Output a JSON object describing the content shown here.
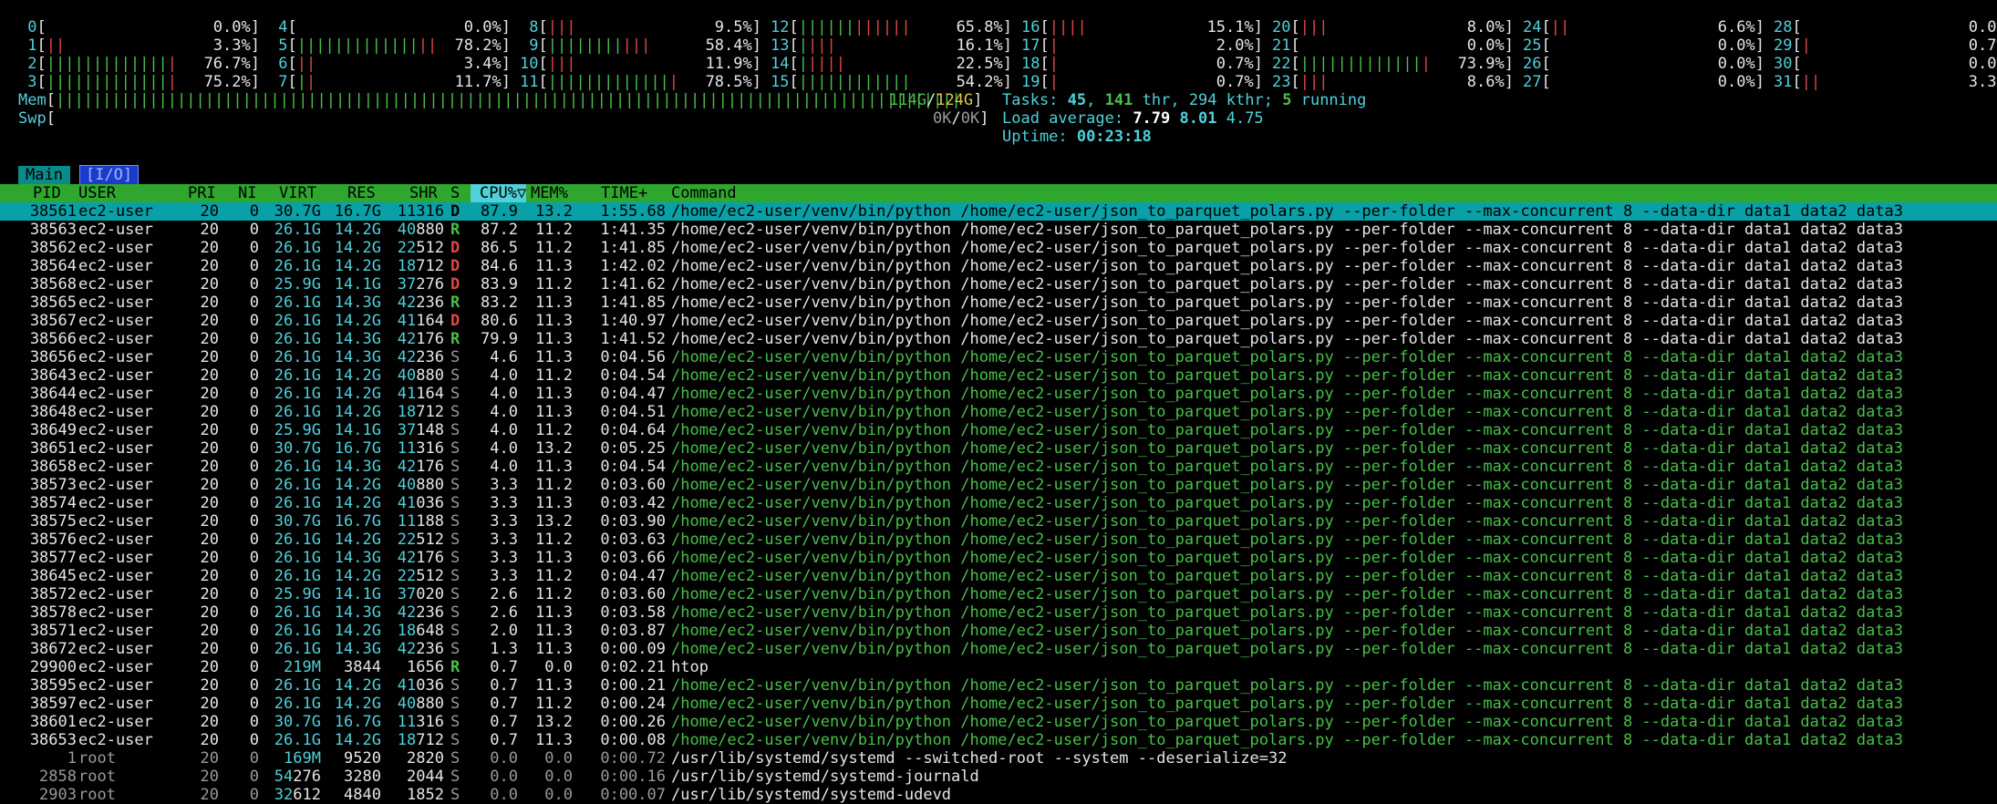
{
  "cpu_meters": [
    {
      "id": "0",
      "pct": "0.0%",
      "green": "",
      "red": "",
      "col": 0,
      "row": 0
    },
    {
      "id": "1",
      "pct": "3.3%",
      "green": "",
      "red": "||",
      "col": 0,
      "row": 1
    },
    {
      "id": "2",
      "pct": "76.7%",
      "green": "|||||||||||||",
      "red": "|",
      "col": 0,
      "row": 2
    },
    {
      "id": "3",
      "pct": "75.2%",
      "green": "|||||||||||||",
      "red": "|",
      "col": 0,
      "row": 3
    },
    {
      "id": "4",
      "pct": "0.0%",
      "green": "",
      "red": "",
      "col": 1,
      "row": 0
    },
    {
      "id": "5",
      "pct": "78.2%",
      "green": "|||||||||||||",
      "red": "||",
      "col": 1,
      "row": 1
    },
    {
      "id": "6",
      "pct": "3.4%",
      "green": "",
      "red": "||",
      "col": 1,
      "row": 2
    },
    {
      "id": "7",
      "pct": "11.7%",
      "green": "|",
      "red": "|",
      "col": 1,
      "row": 3
    },
    {
      "id": "8",
      "pct": "9.5%",
      "green": "",
      "red": "|||",
      "col": 2,
      "row": 0
    },
    {
      "id": "9",
      "pct": "58.4%",
      "green": "||||||||",
      "red": "|||",
      "col": 2,
      "row": 1
    },
    {
      "id": "10",
      "pct": "11.9%",
      "green": "",
      "red": "|||",
      "col": 2,
      "row": 2
    },
    {
      "id": "11",
      "pct": "78.5%",
      "green": "|||||||||||||",
      "red": "|",
      "col": 2,
      "row": 3
    },
    {
      "id": "12",
      "pct": "65.8%",
      "green": "||||||",
      "red": "||||||",
      "col": 3,
      "row": 0
    },
    {
      "id": "13",
      "pct": "16.1%",
      "green": "|",
      "red": "|||",
      "col": 3,
      "row": 1
    },
    {
      "id": "14",
      "pct": "22.5%",
      "green": "|",
      "red": "||||",
      "col": 3,
      "row": 2
    },
    {
      "id": "15",
      "pct": "54.2%",
      "green": "||||||||||||",
      "red": "",
      "col": 3,
      "row": 3
    },
    {
      "id": "16",
      "pct": "15.1%",
      "green": "",
      "red": "||||",
      "col": 4,
      "row": 0
    },
    {
      "id": "17",
      "pct": "2.0%",
      "green": "",
      "red": "|",
      "col": 4,
      "row": 1
    },
    {
      "id": "18",
      "pct": "0.7%",
      "green": "",
      "red": "|",
      "col": 4,
      "row": 2
    },
    {
      "id": "19",
      "pct": "0.7%",
      "green": "",
      "red": "|",
      "col": 4,
      "row": 3
    },
    {
      "id": "20",
      "pct": "8.0%",
      "green": "",
      "red": "|||",
      "col": 5,
      "row": 0
    },
    {
      "id": "21",
      "pct": "0.0%",
      "green": "",
      "red": "",
      "col": 5,
      "row": 1
    },
    {
      "id": "22",
      "pct": "73.9%",
      "green": "|||||||||||||",
      "red": "|",
      "col": 5,
      "row": 2
    },
    {
      "id": "23",
      "pct": "8.6%",
      "green": "",
      "red": "|||",
      "col": 5,
      "row": 3
    },
    {
      "id": "24",
      "pct": "6.6%",
      "green": "",
      "red": "||",
      "col": 6,
      "row": 0
    },
    {
      "id": "25",
      "pct": "0.0%",
      "green": "",
      "red": "",
      "col": 6,
      "row": 1
    },
    {
      "id": "26",
      "pct": "0.0%",
      "green": "",
      "red": "",
      "col": 6,
      "row": 2
    },
    {
      "id": "27",
      "pct": "0.0%",
      "green": "",
      "red": "",
      "col": 6,
      "row": 3
    },
    {
      "id": "28",
      "pct": "0.0%",
      "green": "",
      "red": "",
      "col": 7,
      "row": 0
    },
    {
      "id": "29",
      "pct": "0.7%",
      "green": "",
      "red": "|",
      "col": 7,
      "row": 1
    },
    {
      "id": "30",
      "pct": "0.0%",
      "green": "",
      "red": "",
      "col": 7,
      "row": 2
    },
    {
      "id": "31",
      "pct": "3.3%",
      "green": "",
      "red": "||",
      "col": 7,
      "row": 3
    }
  ],
  "mem": {
    "label": "Mem",
    "used": "114G",
    "total": "124G",
    "bar": "|||||||||||||||||||||||||||||||||||||||||||||||||||||||||||||||||||||||||||||||||||||||||||||||||"
  },
  "swp": {
    "label": "Swp",
    "used": "0K",
    "total": "0K"
  },
  "tasks": {
    "label": "Tasks:",
    "tasks": "45",
    "thr": "141",
    "thr_label": "thr,",
    "kthr": "294",
    "kthr_label": "kthr;",
    "running": "5",
    "running_label": "running"
  },
  "load": {
    "label": "Load average:",
    "one": "7.79",
    "five": "8.01",
    "fifteen": "4.75"
  },
  "uptime": {
    "label": "Uptime:",
    "value": "00:23:18"
  },
  "tabs": {
    "main": "Main",
    "io": "I/O"
  },
  "columns": {
    "pid": "PID",
    "user": "USER",
    "pri": "PRI",
    "ni": "NI",
    "virt": "VIRT",
    "res": "RES",
    "shr": "SHR",
    "s": "S",
    "cpu": "CPU%",
    "sort_arrow": "▽",
    "mem": "MEM%",
    "time": "TIME+",
    "command": "Command"
  },
  "processes": [
    {
      "pid": "38561",
      "user": "ec2-user",
      "pri": "20",
      "ni": "0",
      "virt": "30.7G",
      "res": "16.7G",
      "shr": "11316",
      "s": "D",
      "cpu": "87.9",
      "mem": "13.2",
      "time": "1:55.68",
      "cmd": "/home/ec2-user/venv/bin/python /home/ec2-user/json_to_parquet_polars.py --per-folder --max-concurrent 8 --data-dir data1 data2 data3",
      "selected": true,
      "thread": false
    },
    {
      "pid": "38563",
      "user": "ec2-user",
      "pri": "20",
      "ni": "0",
      "virt": "26.1G",
      "res": "14.2G",
      "shr": "40880",
      "s": "R",
      "cpu": "87.2",
      "mem": "11.2",
      "time": "1:41.35",
      "cmd": "/home/ec2-user/venv/bin/python /home/ec2-user/json_to_parquet_polars.py --per-folder --max-concurrent 8 --data-dir data1 data2 data3",
      "thread": false
    },
    {
      "pid": "38562",
      "user": "ec2-user",
      "pri": "20",
      "ni": "0",
      "virt": "26.1G",
      "res": "14.2G",
      "shr": "22512",
      "s": "D",
      "cpu": "86.5",
      "mem": "11.2",
      "time": "1:41.85",
      "cmd": "/home/ec2-user/venv/bin/python /home/ec2-user/json_to_parquet_polars.py --per-folder --max-concurrent 8 --data-dir data1 data2 data3",
      "thread": false
    },
    {
      "pid": "38564",
      "user": "ec2-user",
      "pri": "20",
      "ni": "0",
      "virt": "26.1G",
      "res": "14.2G",
      "shr": "18712",
      "s": "D",
      "cpu": "84.6",
      "mem": "11.3",
      "time": "1:42.02",
      "cmd": "/home/ec2-user/venv/bin/python /home/ec2-user/json_to_parquet_polars.py --per-folder --max-concurrent 8 --data-dir data1 data2 data3",
      "thread": false
    },
    {
      "pid": "38568",
      "user": "ec2-user",
      "pri": "20",
      "ni": "0",
      "virt": "25.9G",
      "res": "14.1G",
      "shr": "37276",
      "s": "D",
      "cpu": "83.9",
      "mem": "11.2",
      "time": "1:41.62",
      "cmd": "/home/ec2-user/venv/bin/python /home/ec2-user/json_to_parquet_polars.py --per-folder --max-concurrent 8 --data-dir data1 data2 data3",
      "thread": false
    },
    {
      "pid": "38565",
      "user": "ec2-user",
      "pri": "20",
      "ni": "0",
      "virt": "26.1G",
      "res": "14.3G",
      "shr": "42236",
      "s": "R",
      "cpu": "83.2",
      "mem": "11.3",
      "time": "1:41.85",
      "cmd": "/home/ec2-user/venv/bin/python /home/ec2-user/json_to_parquet_polars.py --per-folder --max-concurrent 8 --data-dir data1 data2 data3",
      "thread": false
    },
    {
      "pid": "38567",
      "user": "ec2-user",
      "pri": "20",
      "ni": "0",
      "virt": "26.1G",
      "res": "14.2G",
      "shr": "41164",
      "s": "D",
      "cpu": "80.6",
      "mem": "11.3",
      "time": "1:40.97",
      "cmd": "/home/ec2-user/venv/bin/python /home/ec2-user/json_to_parquet_polars.py --per-folder --max-concurrent 8 --data-dir data1 data2 data3",
      "thread": false
    },
    {
      "pid": "38566",
      "user": "ec2-user",
      "pri": "20",
      "ni": "0",
      "virt": "26.1G",
      "res": "14.3G",
      "shr": "42176",
      "s": "R",
      "cpu": "79.9",
      "mem": "11.3",
      "time": "1:41.52",
      "cmd": "/home/ec2-user/venv/bin/python /home/ec2-user/json_to_parquet_polars.py --per-folder --max-concurrent 8 --data-dir data1 data2 data3",
      "thread": false
    },
    {
      "pid": "38656",
      "user": "ec2-user",
      "pri": "20",
      "ni": "0",
      "virt": "26.1G",
      "res": "14.3G",
      "shr": "42236",
      "s": "S",
      "cpu": "4.6",
      "mem": "11.3",
      "time": "0:04.56",
      "cmd": "/home/ec2-user/venv/bin/python /home/ec2-user/json_to_parquet_polars.py --per-folder --max-concurrent 8 --data-dir data1 data2 data3",
      "thread": true
    },
    {
      "pid": "38643",
      "user": "ec2-user",
      "pri": "20",
      "ni": "0",
      "virt": "26.1G",
      "res": "14.2G",
      "shr": "40880",
      "s": "S",
      "cpu": "4.0",
      "mem": "11.2",
      "time": "0:04.54",
      "cmd": "/home/ec2-user/venv/bin/python /home/ec2-user/json_to_parquet_polars.py --per-folder --max-concurrent 8 --data-dir data1 data2 data3",
      "thread": true
    },
    {
      "pid": "38644",
      "user": "ec2-user",
      "pri": "20",
      "ni": "0",
      "virt": "26.1G",
      "res": "14.2G",
      "shr": "41164",
      "s": "S",
      "cpu": "4.0",
      "mem": "11.3",
      "time": "0:04.47",
      "cmd": "/home/ec2-user/venv/bin/python /home/ec2-user/json_to_parquet_polars.py --per-folder --max-concurrent 8 --data-dir data1 data2 data3",
      "thread": true
    },
    {
      "pid": "38648",
      "user": "ec2-user",
      "pri": "20",
      "ni": "0",
      "virt": "26.1G",
      "res": "14.2G",
      "shr": "18712",
      "s": "S",
      "cpu": "4.0",
      "mem": "11.3",
      "time": "0:04.51",
      "cmd": "/home/ec2-user/venv/bin/python /home/ec2-user/json_to_parquet_polars.py --per-folder --max-concurrent 8 --data-dir data1 data2 data3",
      "thread": true
    },
    {
      "pid": "38649",
      "user": "ec2-user",
      "pri": "20",
      "ni": "0",
      "virt": "25.9G",
      "res": "14.1G",
      "shr": "37148",
      "s": "S",
      "cpu": "4.0",
      "mem": "11.2",
      "time": "0:04.64",
      "cmd": "/home/ec2-user/venv/bin/python /home/ec2-user/json_to_parquet_polars.py --per-folder --max-concurrent 8 --data-dir data1 data2 data3",
      "thread": true
    },
    {
      "pid": "38651",
      "user": "ec2-user",
      "pri": "20",
      "ni": "0",
      "virt": "30.7G",
      "res": "16.7G",
      "shr": "11316",
      "s": "S",
      "cpu": "4.0",
      "mem": "13.2",
      "time": "0:05.25",
      "cmd": "/home/ec2-user/venv/bin/python /home/ec2-user/json_to_parquet_polars.py --per-folder --max-concurrent 8 --data-dir data1 data2 data3",
      "thread": true
    },
    {
      "pid": "38658",
      "user": "ec2-user",
      "pri": "20",
      "ni": "0",
      "virt": "26.1G",
      "res": "14.3G",
      "shr": "42176",
      "s": "S",
      "cpu": "4.0",
      "mem": "11.3",
      "time": "0:04.54",
      "cmd": "/home/ec2-user/venv/bin/python /home/ec2-user/json_to_parquet_polars.py --per-folder --max-concurrent 8 --data-dir data1 data2 data3",
      "thread": true
    },
    {
      "pid": "38573",
      "user": "ec2-user",
      "pri": "20",
      "ni": "0",
      "virt": "26.1G",
      "res": "14.2G",
      "shr": "40880",
      "s": "S",
      "cpu": "3.3",
      "mem": "11.2",
      "time": "0:03.60",
      "cmd": "/home/ec2-user/venv/bin/python /home/ec2-user/json_to_parquet_polars.py --per-folder --max-concurrent 8 --data-dir data1 data2 data3",
      "thread": true
    },
    {
      "pid": "38574",
      "user": "ec2-user",
      "pri": "20",
      "ni": "0",
      "virt": "26.1G",
      "res": "14.2G",
      "shr": "41036",
      "s": "S",
      "cpu": "3.3",
      "mem": "11.3",
      "time": "0:03.42",
      "cmd": "/home/ec2-user/venv/bin/python /home/ec2-user/json_to_parquet_polars.py --per-folder --max-concurrent 8 --data-dir data1 data2 data3",
      "thread": true
    },
    {
      "pid": "38575",
      "user": "ec2-user",
      "pri": "20",
      "ni": "0",
      "virt": "30.7G",
      "res": "16.7G",
      "shr": "11188",
      "s": "S",
      "cpu": "3.3",
      "mem": "13.2",
      "time": "0:03.90",
      "cmd": "/home/ec2-user/venv/bin/python /home/ec2-user/json_to_parquet_polars.py --per-folder --max-concurrent 8 --data-dir data1 data2 data3",
      "thread": true
    },
    {
      "pid": "38576",
      "user": "ec2-user",
      "pri": "20",
      "ni": "0",
      "virt": "26.1G",
      "res": "14.2G",
      "shr": "22512",
      "s": "S",
      "cpu": "3.3",
      "mem": "11.2",
      "time": "0:03.63",
      "cmd": "/home/ec2-user/venv/bin/python /home/ec2-user/json_to_parquet_polars.py --per-folder --max-concurrent 8 --data-dir data1 data2 data3",
      "thread": true
    },
    {
      "pid": "38577",
      "user": "ec2-user",
      "pri": "20",
      "ni": "0",
      "virt": "26.1G",
      "res": "14.3G",
      "shr": "42176",
      "s": "S",
      "cpu": "3.3",
      "mem": "11.3",
      "time": "0:03.66",
      "cmd": "/home/ec2-user/venv/bin/python /home/ec2-user/json_to_parquet_polars.py --per-folder --max-concurrent 8 --data-dir data1 data2 data3",
      "thread": true
    },
    {
      "pid": "38645",
      "user": "ec2-user",
      "pri": "20",
      "ni": "0",
      "virt": "26.1G",
      "res": "14.2G",
      "shr": "22512",
      "s": "S",
      "cpu": "3.3",
      "mem": "11.2",
      "time": "0:04.47",
      "cmd": "/home/ec2-user/venv/bin/python /home/ec2-user/json_to_parquet_polars.py --per-folder --max-concurrent 8 --data-dir data1 data2 data3",
      "thread": true
    },
    {
      "pid": "38572",
      "user": "ec2-user",
      "pri": "20",
      "ni": "0",
      "virt": "25.9G",
      "res": "14.1G",
      "shr": "37020",
      "s": "S",
      "cpu": "2.6",
      "mem": "11.2",
      "time": "0:03.60",
      "cmd": "/home/ec2-user/venv/bin/python /home/ec2-user/json_to_parquet_polars.py --per-folder --max-concurrent 8 --data-dir data1 data2 data3",
      "thread": true
    },
    {
      "pid": "38578",
      "user": "ec2-user",
      "pri": "20",
      "ni": "0",
      "virt": "26.1G",
      "res": "14.3G",
      "shr": "42236",
      "s": "S",
      "cpu": "2.6",
      "mem": "11.3",
      "time": "0:03.58",
      "cmd": "/home/ec2-user/venv/bin/python /home/ec2-user/json_to_parquet_polars.py --per-folder --max-concurrent 8 --data-dir data1 data2 data3",
      "thread": true
    },
    {
      "pid": "38571",
      "user": "ec2-user",
      "pri": "20",
      "ni": "0",
      "virt": "26.1G",
      "res": "14.2G",
      "shr": "18648",
      "s": "S",
      "cpu": "2.0",
      "mem": "11.3",
      "time": "0:03.87",
      "cmd": "/home/ec2-user/venv/bin/python /home/ec2-user/json_to_parquet_polars.py --per-folder --max-concurrent 8 --data-dir data1 data2 data3",
      "thread": true
    },
    {
      "pid": "38672",
      "user": "ec2-user",
      "pri": "20",
      "ni": "0",
      "virt": "26.1G",
      "res": "14.3G",
      "shr": "42236",
      "s": "S",
      "cpu": "1.3",
      "mem": "11.3",
      "time": "0:00.09",
      "cmd": "/home/ec2-user/venv/bin/python /home/ec2-user/json_to_parquet_polars.py --per-folder --max-concurrent 8 --data-dir data1 data2 data3",
      "thread": true
    },
    {
      "pid": "29900",
      "user": "ec2-user",
      "pri": "20",
      "ni": "0",
      "virt": "219M",
      "res": "3844",
      "shr": "1656",
      "s": "R",
      "cpu": "0.7",
      "mem": "0.0",
      "time": "0:02.21",
      "cmd": "htop",
      "thread": false
    },
    {
      "pid": "38595",
      "user": "ec2-user",
      "pri": "20",
      "ni": "0",
      "virt": "26.1G",
      "res": "14.2G",
      "shr": "41036",
      "s": "S",
      "cpu": "0.7",
      "mem": "11.3",
      "time": "0:00.21",
      "cmd": "/home/ec2-user/venv/bin/python /home/ec2-user/json_to_parquet_polars.py --per-folder --max-concurrent 8 --data-dir data1 data2 data3",
      "thread": true
    },
    {
      "pid": "38597",
      "user": "ec2-user",
      "pri": "20",
      "ni": "0",
      "virt": "26.1G",
      "res": "14.2G",
      "shr": "40880",
      "s": "S",
      "cpu": "0.7",
      "mem": "11.2",
      "time": "0:00.24",
      "cmd": "/home/ec2-user/venv/bin/python /home/ec2-user/json_to_parquet_polars.py --per-folder --max-concurrent 8 --data-dir data1 data2 data3",
      "thread": true
    },
    {
      "pid": "38601",
      "user": "ec2-user",
      "pri": "20",
      "ni": "0",
      "virt": "30.7G",
      "res": "16.7G",
      "shr": "11316",
      "s": "S",
      "cpu": "0.7",
      "mem": "13.2",
      "time": "0:00.26",
      "cmd": "/home/ec2-user/venv/bin/python /home/ec2-user/json_to_parquet_polars.py --per-folder --max-concurrent 8 --data-dir data1 data2 data3",
      "thread": true
    },
    {
      "pid": "38653",
      "user": "ec2-user",
      "pri": "20",
      "ni": "0",
      "virt": "26.1G",
      "res": "14.2G",
      "shr": "18712",
      "s": "S",
      "cpu": "0.7",
      "mem": "11.3",
      "time": "0:00.08",
      "cmd": "/home/ec2-user/venv/bin/python /home/ec2-user/json_to_parquet_polars.py --per-folder --max-concurrent 8 --data-dir data1 data2 data3",
      "thread": true
    },
    {
      "pid": "1",
      "user": "root",
      "pri": "20",
      "ni": "0",
      "virt": "169M",
      "res": "9520",
      "shr": "2820",
      "s": "S",
      "cpu": "0.0",
      "mem": "0.0",
      "time": "0:00.72",
      "cmd": "/usr/lib/systemd/systemd --switched-root --system --deserialize=32",
      "thread": false
    },
    {
      "pid": "2858",
      "user": "root",
      "pri": "20",
      "ni": "0",
      "virt": "54276",
      "res": "3280",
      "shr": "2044",
      "s": "S",
      "cpu": "0.0",
      "mem": "0.0",
      "time": "0:00.16",
      "cmd": "/usr/lib/systemd/systemd-journald",
      "thread": false
    },
    {
      "pid": "2903",
      "user": "root",
      "pri": "20",
      "ni": "0",
      "virt": "32612",
      "res": "4840",
      "shr": "1852",
      "s": "S",
      "cpu": "0.0",
      "mem": "0.0",
      "time": "0:00.07",
      "cmd": "/usr/lib/systemd/systemd-udevd",
      "thread": false
    }
  ]
}
